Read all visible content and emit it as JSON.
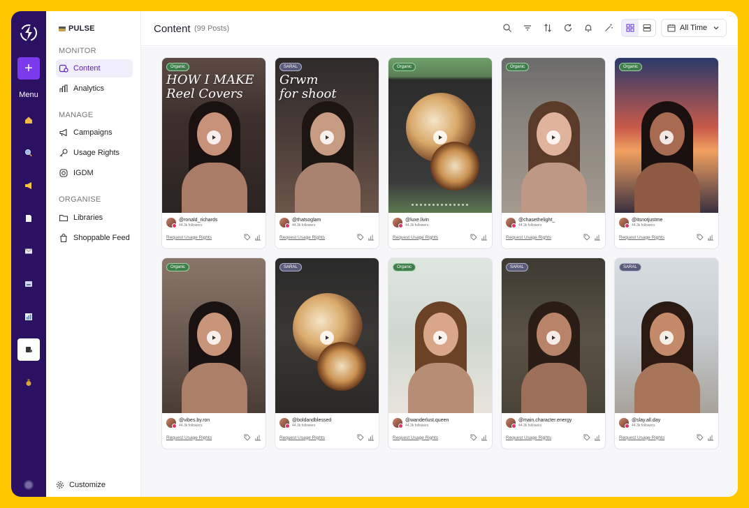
{
  "app": {
    "brand": "PULSE",
    "accent": "#7c3aed",
    "rail_color": "#2a1161",
    "frame_color": "#FFC700"
  },
  "rail": {
    "plus_label": "+",
    "menu_label": "Menu",
    "icons": [
      "home-icon",
      "search-icon",
      "megaphone-icon",
      "document-icon",
      "mail-icon",
      "inbox-icon",
      "chart-icon",
      "content-icon",
      "money-bag-icon"
    ]
  },
  "sidebar": {
    "monitor_label": "MONITOR",
    "manage_label": "MANAGE",
    "organise_label": "ORGANISE",
    "items": {
      "content": "Content",
      "analytics": "Analytics",
      "campaigns": "Campaigns",
      "usage_rights": "Usage Rights",
      "igdm": "IGDM",
      "libraries": "Libraries",
      "shoppable_feed": "Shoppable Feed"
    },
    "customize": "Customize"
  },
  "header": {
    "title": "Content",
    "count": "(99 Posts)",
    "time_filter": "All Time"
  },
  "posts": [
    {
      "badge": "Organic",
      "handle": "@ronald_richards",
      "followers": "44.3k followers",
      "action": "Request Usage Rights",
      "overlay": "HOW I MAKE\nReel Covers",
      "bg": "linear-gradient(180deg,#5d4a44 0%,#3d2f2c 40%,#2a2422 100%)",
      "skin": "#c8927a",
      "hair": "#1a1210"
    },
    {
      "badge": "SARAL",
      "handle": "@thatsoglam",
      "followers": "44.3k followers",
      "action": "Request Usage Rights",
      "overlay": "Grwm\nfor shoot",
      "bg": "linear-gradient(180deg,#2e2a2a 0%,#4a3d38 50%,#6b5548 100%)",
      "skin": "#c79a82",
      "hair": "#1d1512"
    },
    {
      "badge": "Organic",
      "handle": "@luxe.livin",
      "followers": "44.3k followers",
      "action": "Request Usage Rights",
      "overlay": "",
      "bg": "linear-gradient(180deg,#6fa06a 0%,#5a7d55 12%,#2c2c2c 14%,#3a3a3a 80%,#5c7a52 100%)",
      "skin": "",
      "hair": "",
      "food": true
    },
    {
      "badge": "Organic",
      "handle": "@chasethelight_",
      "followers": "44.3k followers",
      "action": "Request Usage Rights",
      "overlay": "",
      "bg": "linear-gradient(180deg,#6b6b6b 0%,#8a847d 40%,#a39a8e 100%)",
      "skin": "#e0b39c",
      "hair": "#5a3a28"
    },
    {
      "badge": "Organic",
      "handle": "@itsnotjustme",
      "followers": "44.3k followers",
      "action": "Request Usage Rights",
      "overlay": "",
      "bg": "linear-gradient(180deg,#2a3a6a 0%,#c85a4a 45%,#f0a060 60%,#3a3040 100%)",
      "skin": "#a86a50",
      "hair": "#1a1010"
    },
    {
      "badge": "Organic",
      "handle": "@vibes.by.ron",
      "followers": "44.3k followers",
      "action": "Request Usage Rights",
      "overlay": "",
      "bg": "linear-gradient(180deg,#8a7668 0%,#6b5a50 50%,#4a3d36 100%)",
      "skin": "#c9957a",
      "hair": "#1a1210"
    },
    {
      "badge": "SARAL",
      "handle": "@boldandblessed",
      "followers": "44.3k followers",
      "action": "Request Usage Rights",
      "overlay": "",
      "bg": "linear-gradient(180deg,#2a2a2a 0%,#3a3835 50%,#2a2826 100%)",
      "skin": "",
      "hair": "",
      "food": true
    },
    {
      "badge": "Organic",
      "handle": "@wanderlust.queen",
      "followers": "44.3k followers",
      "action": "Request Usage Rights",
      "overlay": "",
      "bg": "linear-gradient(180deg,#dfe6e0 0%,#cfd8d0 50%,#e8e4dc 100%)",
      "skin": "#d9a68a",
      "hair": "#6b4226"
    },
    {
      "badge": "SARAL",
      "handle": "@main.character.energy",
      "followers": "44.3k followers",
      "action": "Request Usage Rights",
      "overlay": "",
      "bg": "linear-gradient(180deg,#3e3a32 0%,#5a5244 50%,#4a4438 100%)",
      "skin": "#b9836a",
      "hair": "#2a1d16"
    },
    {
      "badge": "SARAL",
      "handle": "@slay.all.day",
      "followers": "44.3k followers",
      "action": "Request Usage Rights",
      "overlay": "",
      "bg": "linear-gradient(180deg,#d8dde2 0%,#c5cbd0 50%,#a8a29a 100%)",
      "skin": "#c48a6a",
      "hair": "#2a1a12"
    }
  ]
}
